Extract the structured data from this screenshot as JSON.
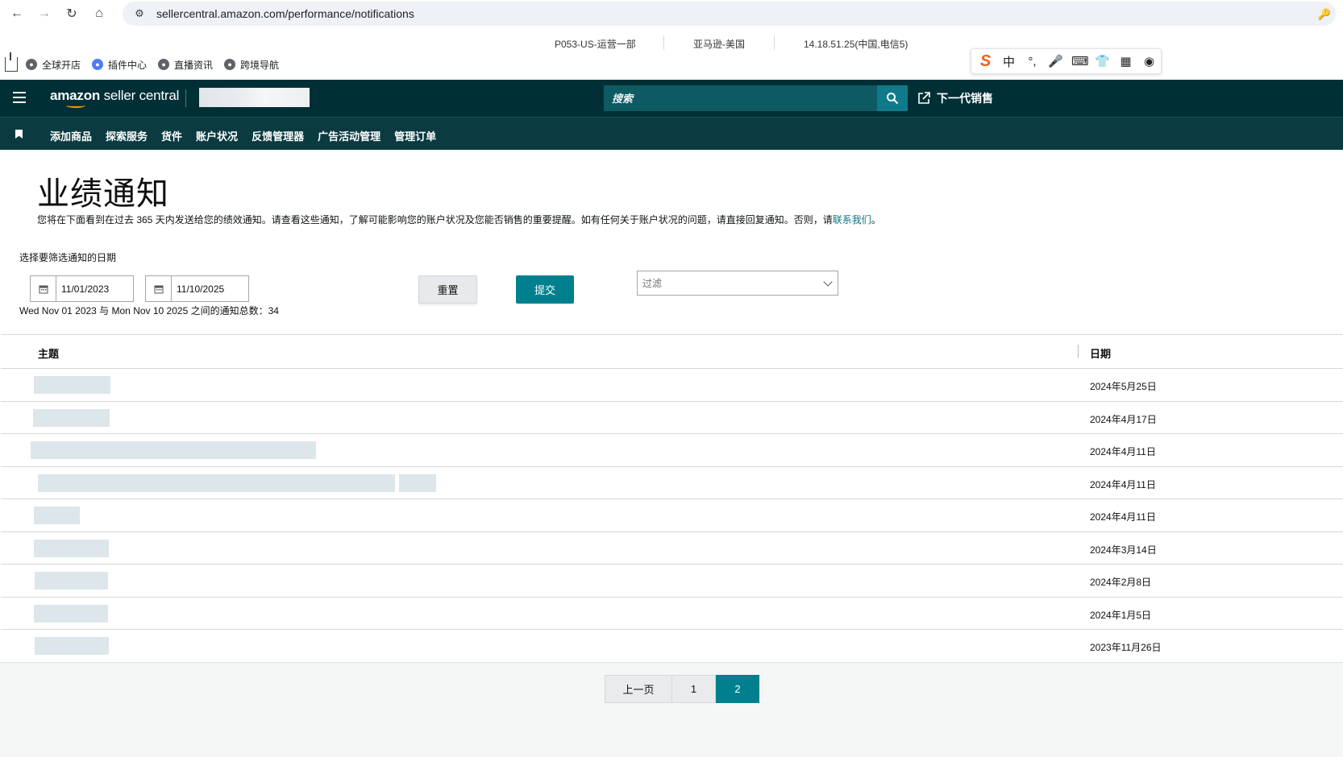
{
  "browser": {
    "url": "sellercentral.amazon.com/performance/notifications"
  },
  "store_info": {
    "account": "P053-US-运营一部",
    "marketplace": "亚马逊-美国",
    "ip": "14.18.51.25(中国,电信5)"
  },
  "bookmarks": [
    "全球开店",
    "插件中心",
    "直播资讯",
    "跨境导航"
  ],
  "ime_toolbar": {
    "lang": "中"
  },
  "header": {
    "logo_bold": "amazon",
    "logo_rest": " seller central",
    "search_placeholder": "搜索",
    "next_gen_label": "下一代销售"
  },
  "menu": [
    "添加商品",
    "探索服务",
    "货件",
    "账户状况",
    "反馈管理器",
    "广告活动管理",
    "管理订单"
  ],
  "page": {
    "title": "业绩通知",
    "description": "您将在下面看到在过去 365 天内发送给您的绩效通知。请查看这些通知，了解可能影响您的账户状况及您能否销售的重要提醒。如有任何关于账户状况的问题，请直接回复通知。否则，请",
    "contact_link": "联系我们",
    "description_end": "。"
  },
  "filter": {
    "date_label": "选择要筛选通知的日期",
    "start_date": "11/01/2023",
    "end_date": "11/10/2025",
    "summary": "Wed Nov 01 2023 与 Mon Nov 10 2025 之间的通知总数：34",
    "reset_label": "重置",
    "submit_label": "提交",
    "filter_placeholder": "过滤"
  },
  "table": {
    "col_subject": "主题",
    "col_date": "日期",
    "rows": [
      {
        "date": "2024年5月25日"
      },
      {
        "date": "2024年4月17日"
      },
      {
        "date": "2024年4月11日"
      },
      {
        "date": "2024年4月11日"
      },
      {
        "date": "2024年4月11日"
      },
      {
        "date": "2024年3月14日"
      },
      {
        "date": "2024年2月8日"
      },
      {
        "date": "2024年1月5日"
      },
      {
        "date": "2023年11月26日"
      }
    ]
  },
  "pagination": {
    "prev_label": "上一页",
    "pages": [
      "1",
      "2"
    ],
    "current": "2"
  }
}
